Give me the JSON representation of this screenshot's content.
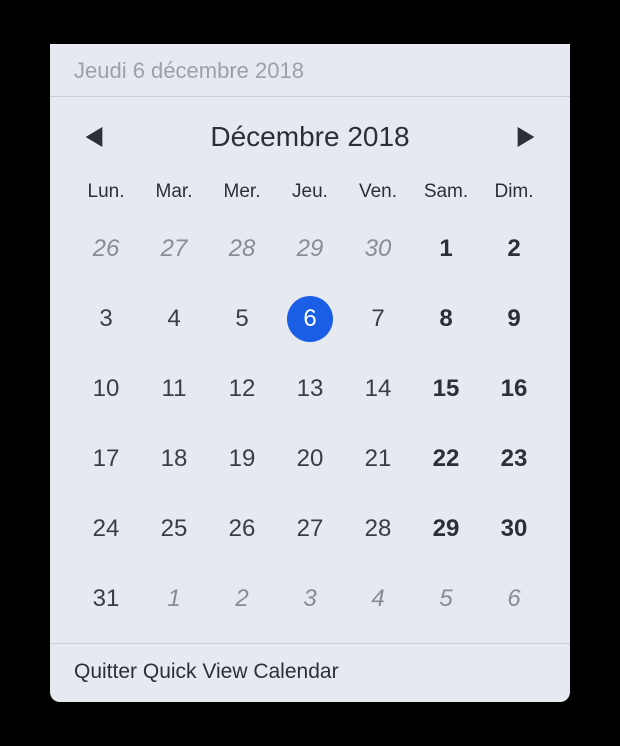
{
  "header": {
    "date_label": "Jeudi 6 décembre 2018"
  },
  "nav": {
    "month_label": "Décembre 2018"
  },
  "weekdays": [
    "Lun.",
    "Mar.",
    "Mer.",
    "Jeu.",
    "Ven.",
    "Sam.",
    "Dim."
  ],
  "days": [
    {
      "n": "26",
      "other": true
    },
    {
      "n": "27",
      "other": true
    },
    {
      "n": "28",
      "other": true
    },
    {
      "n": "29",
      "other": true
    },
    {
      "n": "30",
      "other": true
    },
    {
      "n": "1",
      "weekend": true
    },
    {
      "n": "2",
      "weekend": true
    },
    {
      "n": "3"
    },
    {
      "n": "4"
    },
    {
      "n": "5"
    },
    {
      "n": "6",
      "today": true
    },
    {
      "n": "7"
    },
    {
      "n": "8",
      "weekend": true
    },
    {
      "n": "9",
      "weekend": true
    },
    {
      "n": "10"
    },
    {
      "n": "11"
    },
    {
      "n": "12"
    },
    {
      "n": "13"
    },
    {
      "n": "14"
    },
    {
      "n": "15",
      "weekend": true
    },
    {
      "n": "16",
      "weekend": true
    },
    {
      "n": "17"
    },
    {
      "n": "18"
    },
    {
      "n": "19"
    },
    {
      "n": "20"
    },
    {
      "n": "21"
    },
    {
      "n": "22",
      "weekend": true
    },
    {
      "n": "23",
      "weekend": true
    },
    {
      "n": "24"
    },
    {
      "n": "25"
    },
    {
      "n": "26"
    },
    {
      "n": "27"
    },
    {
      "n": "28"
    },
    {
      "n": "29",
      "weekend": true
    },
    {
      "n": "30",
      "weekend": true
    },
    {
      "n": "31"
    },
    {
      "n": "1",
      "other": true
    },
    {
      "n": "2",
      "other": true
    },
    {
      "n": "3",
      "other": true
    },
    {
      "n": "4",
      "other": true
    },
    {
      "n": "5",
      "other": true
    },
    {
      "n": "6",
      "other": true
    }
  ],
  "footer": {
    "quit_label": "Quitter Quick View Calendar"
  }
}
